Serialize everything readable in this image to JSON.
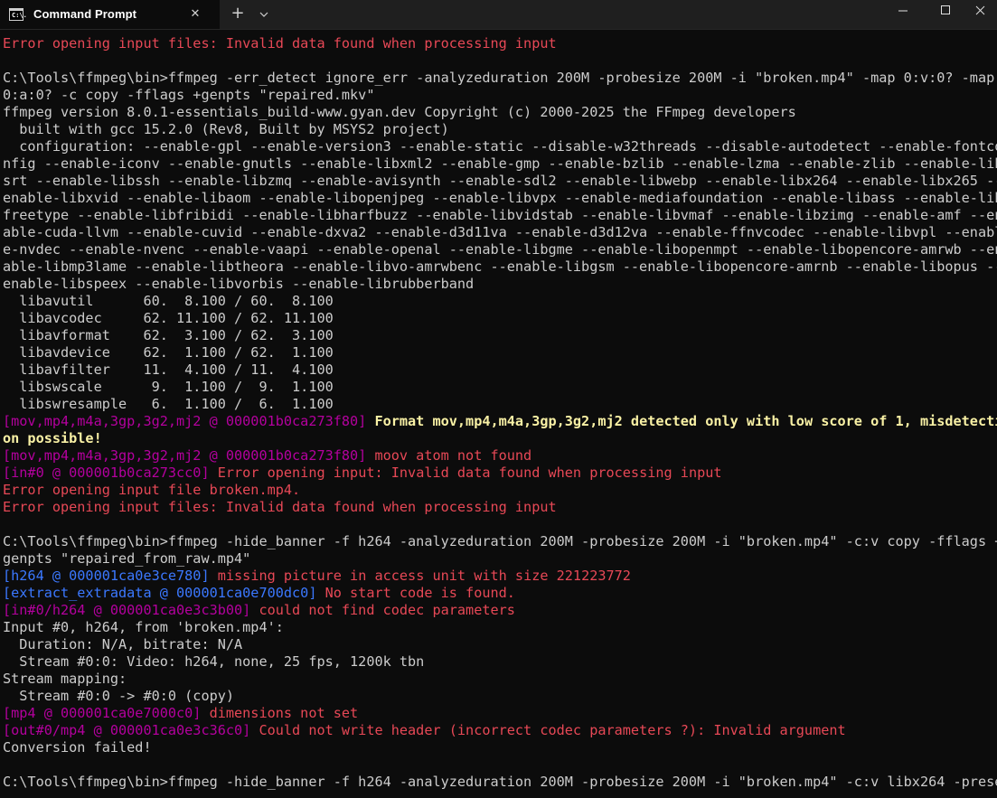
{
  "window": {
    "tab_title": "Command Prompt",
    "tab_icon_text": "C:\\.",
    "close_tab_glyph": "✕",
    "new_tab_glyph": "+"
  },
  "console": {
    "lines": [
      [
        {
          "t": "Error opening input files: Invalid data found when processing input",
          "c": "red"
        }
      ],
      [],
      [
        {
          "t": "C:\\Tools\\ffmpeg\\bin>ffmpeg -err_detect ignore_err -analyzeduration 200M -probesize 200M -i \"broken.mp4\" -map 0:v:0? -map"
        }
      ],
      [
        {
          "t": "0:a:0? -c copy -fflags +genpts \"repaired.mkv\""
        }
      ],
      [
        {
          "t": "ffmpeg version 8.0.1-essentials_build-www.gyan.dev Copyright (c) 2000-2025 the FFmpeg developers"
        }
      ],
      [
        {
          "t": "  built with gcc 15.2.0 (Rev8, Built by MSYS2 project)"
        }
      ],
      [
        {
          "t": "  configuration: --enable-gpl --enable-version3 --enable-static --disable-w32threads --disable-autodetect --enable-fontco"
        }
      ],
      [
        {
          "t": "nfig --enable-iconv --enable-gnutls --enable-libxml2 --enable-gmp --enable-bzlib --enable-lzma --enable-zlib --enable-lib"
        }
      ],
      [
        {
          "t": "srt --enable-libssh --enable-libzmq --enable-avisynth --enable-sdl2 --enable-libwebp --enable-libx264 --enable-libx265 --"
        }
      ],
      [
        {
          "t": "enable-libxvid --enable-libaom --enable-libopenjpeg --enable-libvpx --enable-mediafoundation --enable-libass --enable-lib"
        }
      ],
      [
        {
          "t": "freetype --enable-libfribidi --enable-libharfbuzz --enable-libvidstab --enable-libvmaf --enable-libzimg --enable-amf --en"
        }
      ],
      [
        {
          "t": "able-cuda-llvm --enable-cuvid --enable-dxva2 --enable-d3d11va --enable-d3d12va --enable-ffnvcodec --enable-libvpl --enabl"
        }
      ],
      [
        {
          "t": "e-nvdec --enable-nvenc --enable-vaapi --enable-openal --enable-libgme --enable-libopenmpt --enable-libopencore-amrwb --en"
        }
      ],
      [
        {
          "t": "able-libmp3lame --enable-libtheora --enable-libvo-amrwbenc --enable-libgsm --enable-libopencore-amrnb --enable-libopus --"
        }
      ],
      [
        {
          "t": "enable-libspeex --enable-libvorbis --enable-librubberband"
        }
      ],
      [
        {
          "t": "  libavutil      60.  8.100 / 60.  8.100"
        }
      ],
      [
        {
          "t": "  libavcodec     62. 11.100 / 62. 11.100"
        }
      ],
      [
        {
          "t": "  libavformat    62.  3.100 / 62.  3.100"
        }
      ],
      [
        {
          "t": "  libavdevice    62.  1.100 / 62.  1.100"
        }
      ],
      [
        {
          "t": "  libavfilter    11.  4.100 / 11.  4.100"
        }
      ],
      [
        {
          "t": "  libswscale      9.  1.100 /  9.  1.100"
        }
      ],
      [
        {
          "t": "  libswresample   6.  1.100 /  6.  1.100"
        }
      ],
      [
        {
          "t": "[mov,mp4,m4a,3gp,3g2,mj2 @ 000001b0ca273f80] ",
          "c": "magenta"
        },
        {
          "t": "Format mov,mp4,m4a,3gp,3g2,mj2 detected only with low score of 1, misdetecti",
          "c": "yellow bold"
        }
      ],
      [
        {
          "t": "on possible!",
          "c": "yellow bold"
        }
      ],
      [
        {
          "t": "[mov,mp4,m4a,3gp,3g2,mj2 @ 000001b0ca273f80] ",
          "c": "magenta"
        },
        {
          "t": "moov atom not found",
          "c": "red"
        }
      ],
      [
        {
          "t": "[in#0 @ 000001b0ca273cc0] ",
          "c": "magenta"
        },
        {
          "t": "Error opening input: Invalid data found when processing input",
          "c": "red"
        }
      ],
      [
        {
          "t": "Error opening input file broken.mp4.",
          "c": "red"
        }
      ],
      [
        {
          "t": "Error opening input files: Invalid data found when processing input",
          "c": "red"
        }
      ],
      [],
      [
        {
          "t": "C:\\Tools\\ffmpeg\\bin>ffmpeg -hide_banner -f h264 -analyzeduration 200M -probesize 200M -i \"broken.mp4\" -c:v copy -fflags +"
        }
      ],
      [
        {
          "t": "genpts \"repaired_from_raw.mp4\""
        }
      ],
      [
        {
          "t": "[h264 @ 000001ca0e3ce780] ",
          "c": "blue"
        },
        {
          "t": "missing picture in access unit with size 221223772",
          "c": "red"
        }
      ],
      [
        {
          "t": "[extract_extradata @ 000001ca0e700dc0] ",
          "c": "blue"
        },
        {
          "t": "No start code is found.",
          "c": "red"
        }
      ],
      [
        {
          "t": "[in#0/h264 @ 000001ca0e3c3b00] ",
          "c": "magenta"
        },
        {
          "t": "could not find codec parameters",
          "c": "red"
        }
      ],
      [
        {
          "t": "Input #0, h264, from 'broken.mp4':"
        }
      ],
      [
        {
          "t": "  Duration: N/A, bitrate: N/A"
        }
      ],
      [
        {
          "t": "  Stream #0:0: Video: h264, none, 25 fps, 1200k tbn"
        }
      ],
      [
        {
          "t": "Stream mapping:"
        }
      ],
      [
        {
          "t": "  Stream #0:0 -> #0:0 (copy)"
        }
      ],
      [
        {
          "t": "[mp4 @ 000001ca0e7000c0] ",
          "c": "magenta"
        },
        {
          "t": "dimensions not set",
          "c": "red"
        }
      ],
      [
        {
          "t": "[out#0/mp4 @ 000001ca0e3c36c0] ",
          "c": "magenta"
        },
        {
          "t": "Could not write header (incorrect codec parameters ?): Invalid argument",
          "c": "red"
        }
      ],
      [
        {
          "t": "Conversion failed!"
        }
      ],
      [],
      [
        {
          "t": "C:\\Tools\\ffmpeg\\bin>ffmpeg -hide_banner -f h264 -analyzeduration 200M -probesize 200M -i \"broken.mp4\" -c:v libx264 -prese"
        }
      ]
    ]
  }
}
